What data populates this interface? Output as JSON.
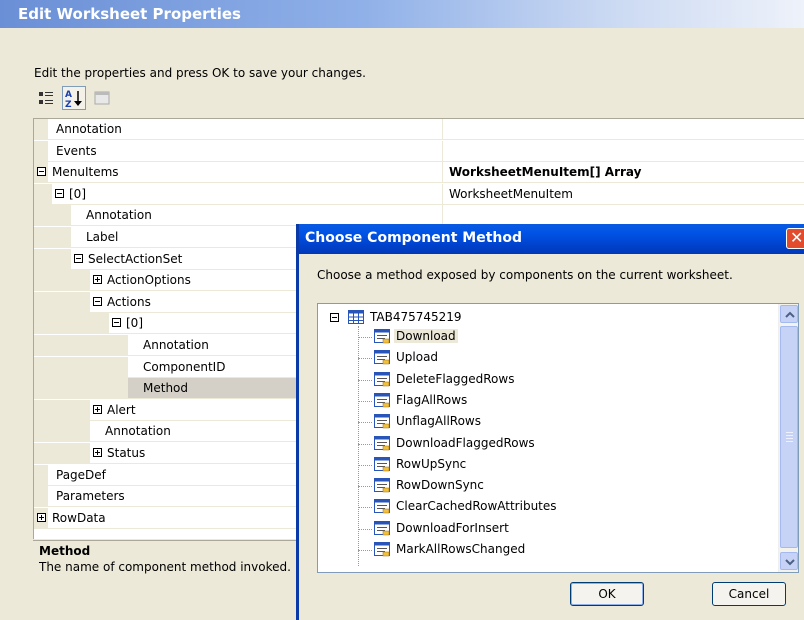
{
  "outer_dialog": {
    "title": "Edit Worksheet Properties",
    "instruction": "Edit the properties and press OK to save your changes.",
    "toolbar": {
      "categorized_icon": "categorized-icon",
      "alphabetical_icon": "sort-alphabetical-icon",
      "property_pages_icon": "property-pages-icon"
    }
  },
  "property_grid": {
    "rows": [
      {
        "label": "Annotation",
        "value": "",
        "level": 0,
        "expander": "none"
      },
      {
        "label": "Events",
        "value": "",
        "level": 0,
        "expander": "none"
      },
      {
        "label": "MenuItems",
        "value": "WorksheetMenuItem[] Array",
        "level": 0,
        "expander": "minus",
        "bold_value": true
      },
      {
        "label": "[0]",
        "value": "WorksheetMenuItem",
        "level": 1,
        "expander": "minus"
      },
      {
        "label": "Annotation",
        "value": "",
        "level": 2,
        "expander": "none"
      },
      {
        "label": "Label",
        "value": "",
        "level": 2,
        "expander": "none"
      },
      {
        "label": "SelectActionSet",
        "value": "",
        "level": 2,
        "expander": "minus"
      },
      {
        "label": "ActionOptions",
        "value": "",
        "level": 3,
        "expander": "plus"
      },
      {
        "label": "Actions",
        "value": "",
        "level": 3,
        "expander": "minus"
      },
      {
        "label": "[0]",
        "value": "",
        "level": 4,
        "expander": "minus"
      },
      {
        "label": "Annotation",
        "value": "",
        "level": 5,
        "expander": "none"
      },
      {
        "label": "ComponentID",
        "value": "",
        "level": 5,
        "expander": "none"
      },
      {
        "label": "Method",
        "value": "",
        "level": 5,
        "expander": "none",
        "selected": true
      },
      {
        "label": "Alert",
        "value": "",
        "level": 3,
        "expander": "plus"
      },
      {
        "label": "Annotation",
        "value": "",
        "level": 3,
        "expander": "none"
      },
      {
        "label": "Status",
        "value": "",
        "level": 3,
        "expander": "plus"
      },
      {
        "label": "PageDef",
        "value": "",
        "level": 0,
        "expander": "none"
      },
      {
        "label": "Parameters",
        "value": "",
        "level": 0,
        "expander": "none"
      },
      {
        "label": "RowData",
        "value": "",
        "level": 0,
        "expander": "plus"
      }
    ]
  },
  "description": {
    "title": "Method",
    "text": "The name of component method invoked."
  },
  "chooser": {
    "title": "Choose Component Method",
    "instruction": "Choose a method exposed by components on the current worksheet.",
    "root_label": "TAB475745219",
    "root_icon": "table-grid-icon",
    "methods": [
      "Download",
      "Upload",
      "DeleteFlaggedRows",
      "FlagAllRows",
      "UnflagAllRows",
      "DownloadFlaggedRows",
      "RowUpSync",
      "RowDownSync",
      "ClearCachedRowAttributes",
      "DownloadForInsert",
      "MarkAllRowsChanged"
    ],
    "selected_method": "Download",
    "ok_label": "OK",
    "cancel_label": "Cancel",
    "close_icon": "close-icon"
  },
  "colors": {
    "title_bar": "#0053e6",
    "outer_title": "#6b8fd6",
    "close_button": "#e24b2c",
    "face": "#ece9d8"
  }
}
